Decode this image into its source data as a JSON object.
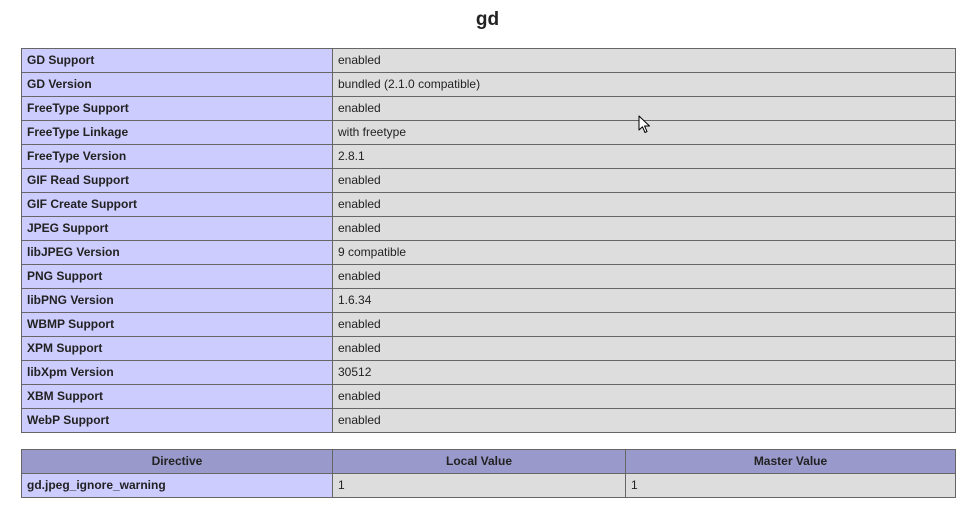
{
  "title": "gd",
  "info_rows": [
    {
      "key": "GD Support",
      "value": "enabled"
    },
    {
      "key": "GD Version",
      "value": "bundled (2.1.0 compatible)"
    },
    {
      "key": "FreeType Support",
      "value": "enabled"
    },
    {
      "key": "FreeType Linkage",
      "value": "with freetype"
    },
    {
      "key": "FreeType Version",
      "value": "2.8.1"
    },
    {
      "key": "GIF Read Support",
      "value": "enabled"
    },
    {
      "key": "GIF Create Support",
      "value": "enabled"
    },
    {
      "key": "JPEG Support",
      "value": "enabled"
    },
    {
      "key": "libJPEG Version",
      "value": "9 compatible"
    },
    {
      "key": "PNG Support",
      "value": "enabled"
    },
    {
      "key": "libPNG Version",
      "value": "1.6.34"
    },
    {
      "key": "WBMP Support",
      "value": "enabled"
    },
    {
      "key": "XPM Support",
      "value": "enabled"
    },
    {
      "key": "libXpm Version",
      "value": "30512"
    },
    {
      "key": "XBM Support",
      "value": "enabled"
    },
    {
      "key": "WebP Support",
      "value": "enabled"
    }
  ],
  "directives": {
    "headers": [
      "Directive",
      "Local Value",
      "Master Value"
    ],
    "rows": [
      {
        "directive": "gd.jpeg_ignore_warning",
        "local": "1",
        "master": "1"
      }
    ]
  },
  "colors": {
    "key_bg": "#ccccff",
    "value_bg": "#dddddd",
    "header_bg": "#9999cc",
    "border": "#666666"
  },
  "icons": {
    "cursor": "mouse-pointer-icon"
  }
}
